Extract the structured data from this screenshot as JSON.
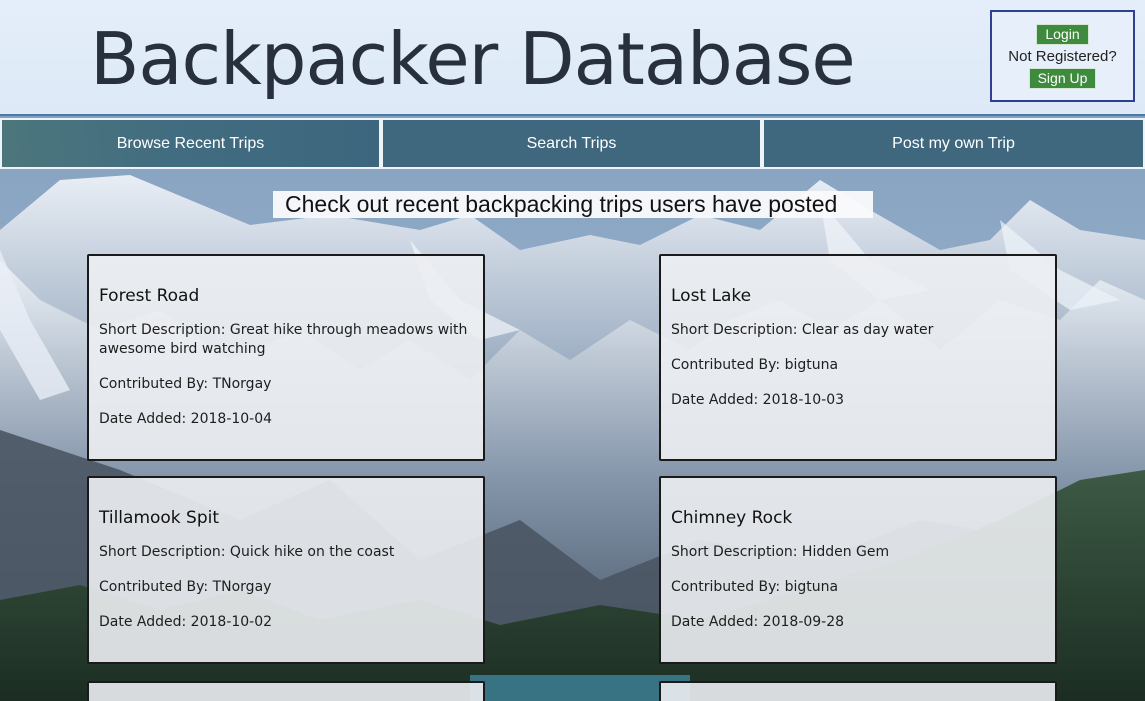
{
  "header": {
    "title": "Backpacker Database",
    "auth": {
      "login_label": "Login",
      "not_registered_text": "Not Registered?",
      "signup_label": "Sign Up"
    }
  },
  "nav": {
    "items": [
      {
        "label": "Browse Recent Trips"
      },
      {
        "label": "Search Trips"
      },
      {
        "label": "Post my own Trip"
      }
    ]
  },
  "main": {
    "heading": "Check out recent backpacking trips users have posted",
    "trips": [
      {
        "title": "Forest Road",
        "description": "Short Description: Great hike through meadows with awesome bird watching",
        "contributor": "Contributed By: TNorgay",
        "date": "Date Added: 2018-10-04"
      },
      {
        "title": "Lost Lake",
        "description": "Short Description: Clear as day water",
        "contributor": "Contributed By: bigtuna",
        "date": "Date Added: 2018-10-03"
      },
      {
        "title": "Tillamook Spit",
        "description": "Short Description: Quick hike on the coast",
        "contributor": "Contributed By: TNorgay",
        "date": "Date Added: 2018-10-02"
      },
      {
        "title": "Chimney Rock",
        "description": "Short Description: Hidden Gem",
        "contributor": "Contributed By: bigtuna",
        "date": "Date Added: 2018-09-28"
      }
    ]
  },
  "colors": {
    "title_text": "#27303c",
    "nav_background": "#38637a",
    "auth_button": "#3e8b3e",
    "auth_border": "#2f3f92",
    "header_border": "#4a7aa6"
  }
}
